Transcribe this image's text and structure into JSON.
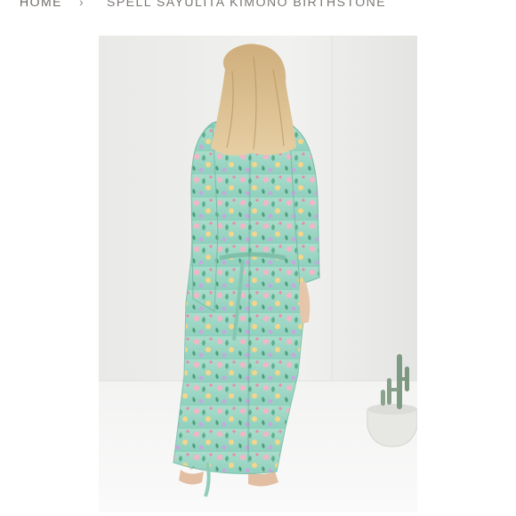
{
  "breadcrumb": {
    "home_label": "HOME",
    "separator": "›",
    "current_label": "SPELL SAYULITA KIMONO BIRTHSTONE"
  },
  "product_image": {
    "subject": "back view of model wearing long mint floral kimono",
    "zoom_icon": "plus-icon"
  },
  "colors": {
    "breadcrumb_text": "#6e6a66",
    "photo_background": "#eeeeec",
    "kimono_base": "#9ed8c4",
    "hair": "#d8b98a"
  }
}
